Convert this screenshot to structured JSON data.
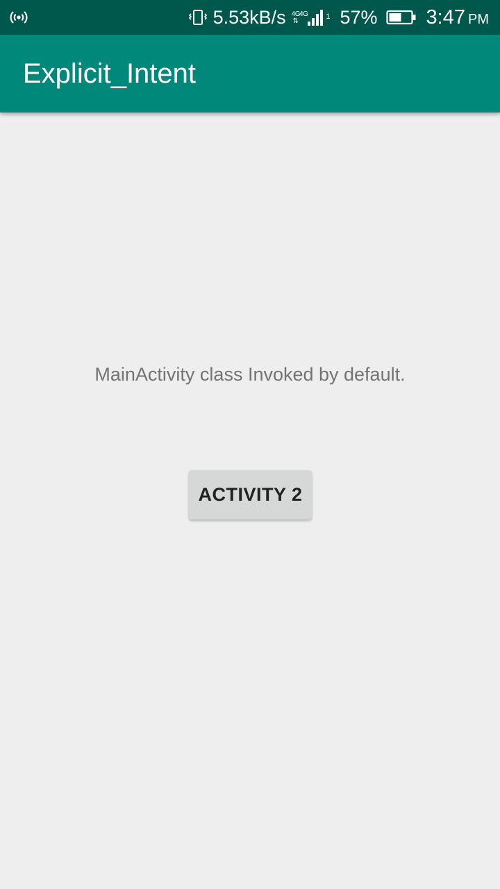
{
  "status_bar": {
    "hotspot_icon": "wifi-tethering-icon",
    "vibrate_icon": "vibrate-icon",
    "net_speed": "5.53kB/s",
    "network_type_1": "4G",
    "network_type_2": "4G",
    "signal_icon": "signal-icon",
    "sim_index": "1",
    "battery_percent": "57%",
    "battery_level": 0.57,
    "time": "3:47",
    "ampm": "PM"
  },
  "app_bar": {
    "title": "Explicit_Intent",
    "color": "#00897b"
  },
  "main": {
    "message": "MainActivity class Invoked by default.",
    "button_label": "ACTIVITY 2"
  },
  "colors": {
    "status_bar": "#00574b",
    "app_bar": "#00897b",
    "background": "#eeeeee",
    "button": "#d6d7d7"
  }
}
